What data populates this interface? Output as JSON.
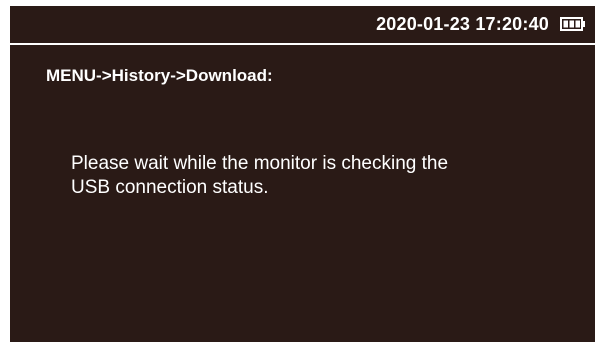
{
  "status_bar": {
    "datetime": "2020-01-23 17:20:40",
    "battery_icon": "battery-icon",
    "battery_level": 1.0
  },
  "breadcrumb": "MENU->History->Download:",
  "message": {
    "line1": "Please wait while the monitor is checking the",
    "line2": "USB connection status."
  },
  "colors": {
    "background": "#2a1a16",
    "text": "#ffffff",
    "frame": "#ffffff"
  }
}
